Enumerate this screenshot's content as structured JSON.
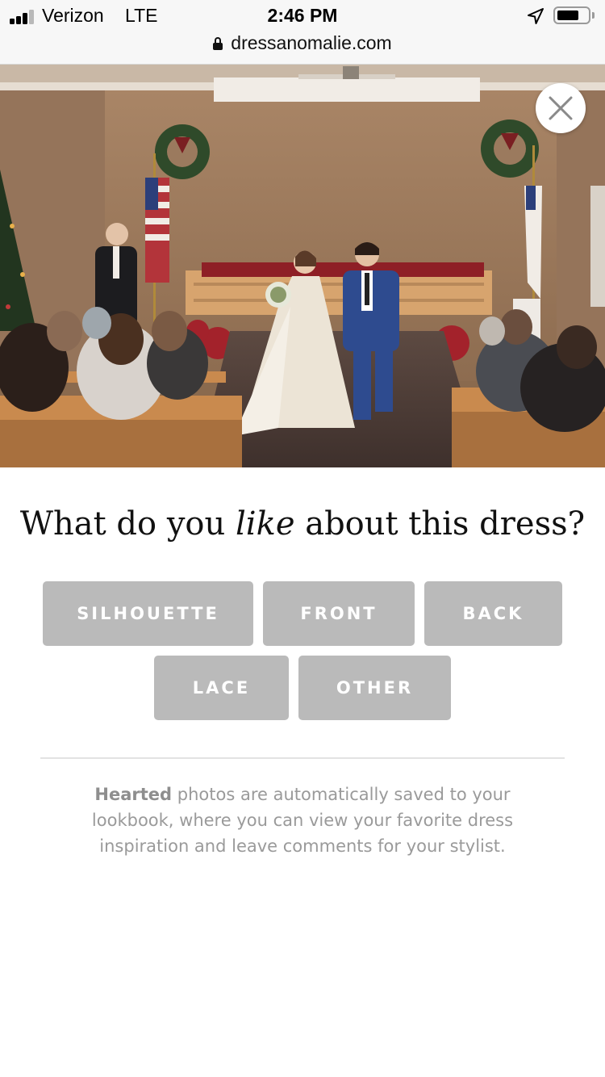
{
  "status_bar": {
    "carrier": "Verizon",
    "network": "LTE",
    "time": "2:46 PM",
    "icons": [
      "signal-icon",
      "location-arrow-icon",
      "battery-icon"
    ]
  },
  "browser": {
    "url": "dressanomalie.com",
    "icon": "lock-icon"
  },
  "photo": {
    "description_icon": "wedding-photo"
  },
  "close": {
    "icon": "close-icon"
  },
  "prompt": {
    "before": "What do you ",
    "emphasis": "like",
    "after": " about this dress?"
  },
  "options": [
    {
      "label": "SILHOUETTE"
    },
    {
      "label": "FRONT"
    },
    {
      "label": "BACK"
    },
    {
      "label": "LACE"
    },
    {
      "label": "OTHER"
    }
  ],
  "footnote": {
    "bold": "Hearted",
    "text": " photos are automatically saved to your lookbook, where you can view your favorite dress inspiration and leave comments for your stylist."
  },
  "colors": {
    "chip_background": "#bababa",
    "chip_text": "#ffffff",
    "footnote_text": "#9a9a9a",
    "heading_text": "#111111"
  }
}
